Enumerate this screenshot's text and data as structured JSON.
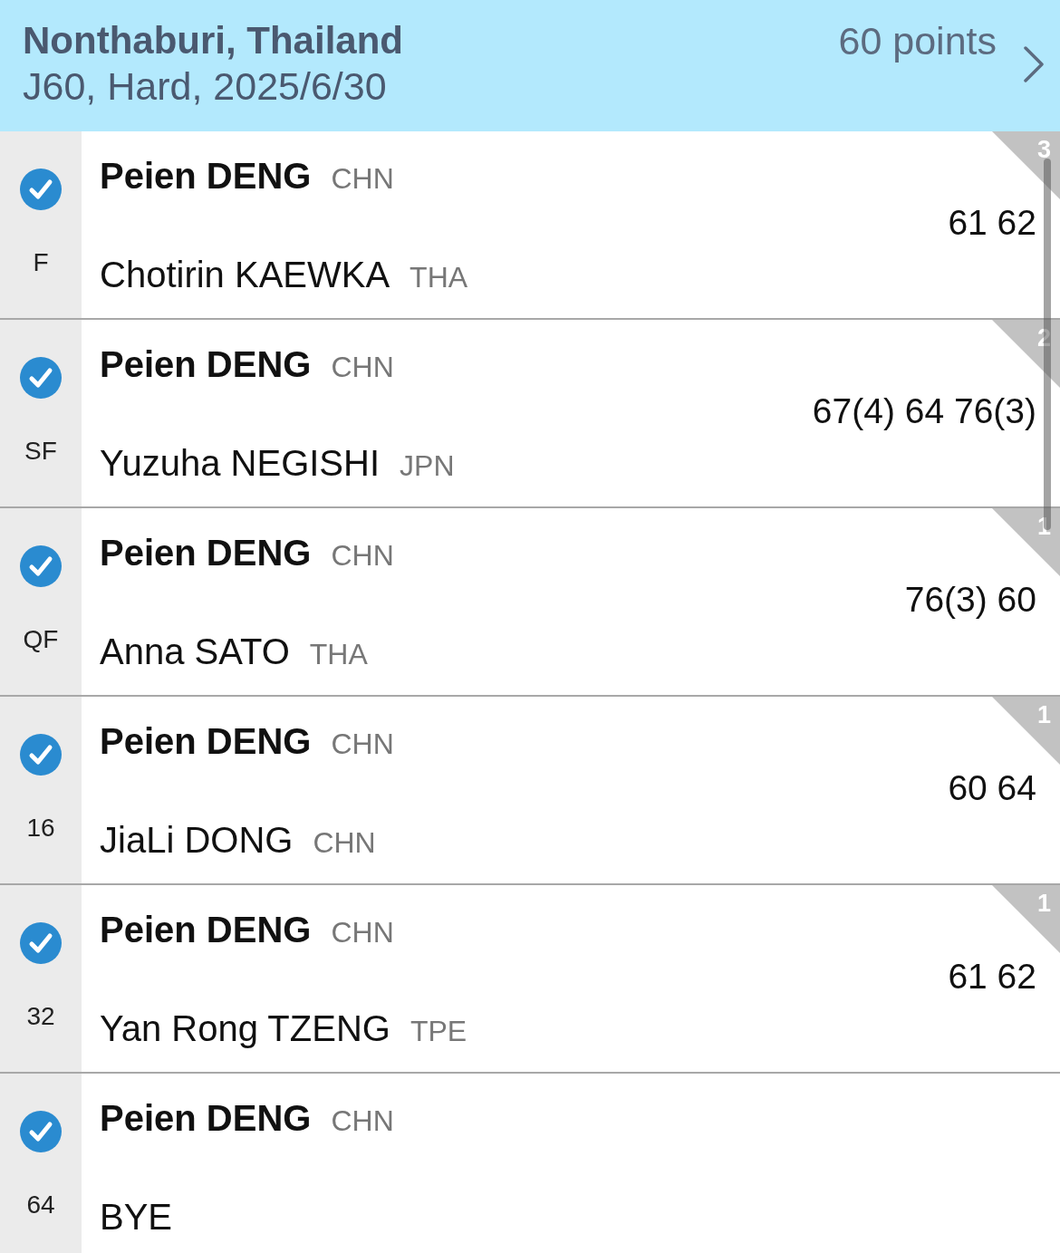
{
  "header": {
    "title": "Nonthaburi, Thailand",
    "subtitle": "J60, Hard, 2025/6/30",
    "points": "60 points"
  },
  "matches": [
    {
      "round": "F",
      "completed": true,
      "player": {
        "name": "Peien DENG",
        "country": "CHN",
        "won": true
      },
      "opponent": {
        "name": "Chotirin KAEWKA",
        "country": "THA",
        "won": false
      },
      "score": "61 62",
      "corner_number": "3"
    },
    {
      "round": "SF",
      "completed": true,
      "player": {
        "name": "Peien DENG",
        "country": "CHN",
        "won": true
      },
      "opponent": {
        "name": "Yuzuha NEGISHI",
        "country": "JPN",
        "won": false
      },
      "score": "67(4) 64 76(3)",
      "corner_number": "2"
    },
    {
      "round": "QF",
      "completed": true,
      "player": {
        "name": "Peien DENG",
        "country": "CHN",
        "won": true
      },
      "opponent": {
        "name": "Anna SATO",
        "country": "THA",
        "won": false
      },
      "score": "76(3) 60",
      "corner_number": "1"
    },
    {
      "round": "16",
      "completed": true,
      "player": {
        "name": "Peien DENG",
        "country": "CHN",
        "won": true
      },
      "opponent": {
        "name": "JiaLi DONG",
        "country": "CHN",
        "won": false
      },
      "score": "60 64",
      "corner_number": "1"
    },
    {
      "round": "32",
      "completed": true,
      "player": {
        "name": "Peien DENG",
        "country": "CHN",
        "won": true
      },
      "opponent": {
        "name": "Yan Rong TZENG",
        "country": "TPE",
        "won": false
      },
      "score": "61 62",
      "corner_number": "1"
    },
    {
      "round": "64",
      "completed": true,
      "player": {
        "name": "Peien DENG",
        "country": "CHN",
        "won": true
      },
      "opponent": {
        "name": "BYE",
        "won": false
      }
    }
  ]
}
